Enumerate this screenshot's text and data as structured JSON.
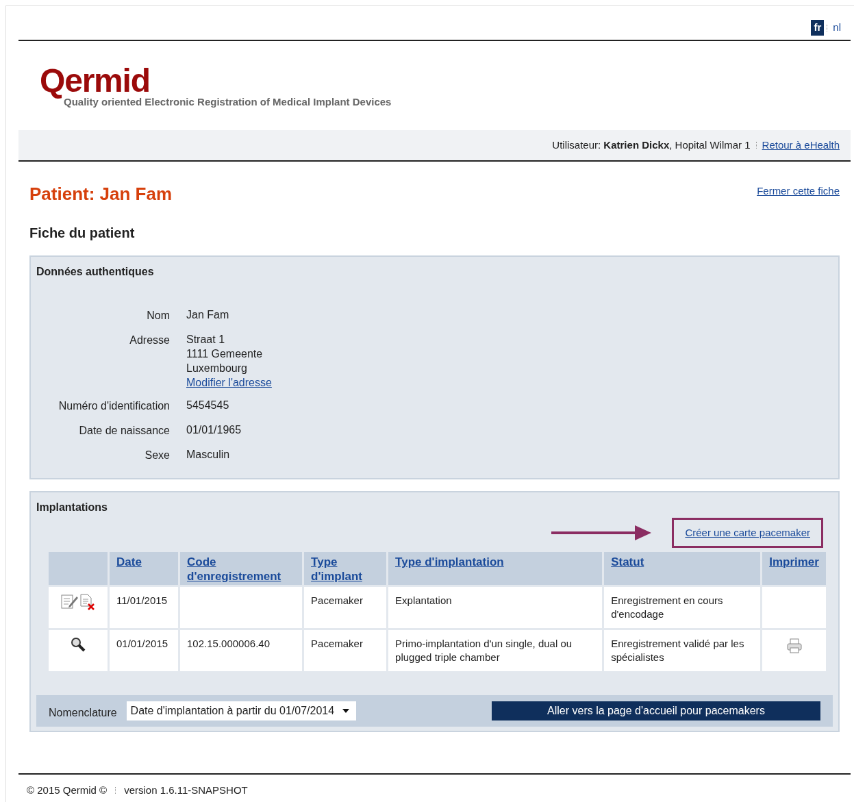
{
  "languages": [
    {
      "label": "fr",
      "selected": true
    },
    {
      "label": "nl",
      "selected": false
    }
  ],
  "logo": {
    "name": "Qermid",
    "tagline": "Quality oriented Electronic Registration of Medical Implant Devices"
  },
  "user_bar": {
    "prefix": "Utilisateur:",
    "user": "Katrien Dickx",
    "org": ", Hopital Wilmar 1",
    "link": "Retour à eHealth"
  },
  "page_title": "Patient: Jan Fam",
  "close_link": "Fermer cette fiche",
  "section_title": "Fiche du patient",
  "authentic": {
    "title": "Données authentiques",
    "fields": [
      {
        "label": "Nom",
        "lines": [
          "Jan Fam"
        ]
      },
      {
        "label": "Adresse",
        "lines": [
          "Straat 1",
          "1111 Gemeente",
          "Luxembourg"
        ],
        "link": "Modifier l'adresse"
      },
      {
        "label": "Numéro d'identification",
        "lines": [
          "5454545"
        ]
      },
      {
        "label": "Date de naissance",
        "lines": [
          "01/01/1965"
        ]
      },
      {
        "label": "Sexe",
        "lines": [
          "Masculin"
        ]
      }
    ]
  },
  "implantations": {
    "title": "Implantations",
    "create_link": {
      "label": "Créer une carte pacemaker",
      "highlighted": true
    },
    "columns": [
      "Date",
      "Code d'enregistrement",
      "Type d'implant",
      "Type d'implantation",
      "Statut",
      "Imprimer"
    ],
    "rows": [
      {
        "can_edit": true,
        "can_delete": true,
        "can_view": false,
        "cells": [
          "11/01/2015",
          "",
          "Pacemaker",
          "Explantation",
          "Enregistrement en cours d'encodage"
        ],
        "printable": false
      },
      {
        "can_edit": false,
        "can_delete": false,
        "can_view": true,
        "cells": [
          "01/01/2015",
          "102.15.000006.40",
          "Pacemaker",
          "Primo-implantation d'un single, dual ou plugged triple chamber",
          "Enregistrement validé par les spécialistes"
        ],
        "printable": true
      }
    ],
    "nomenclature_label": "Nomenclature",
    "nomenclature_value": "Date d'implantation à partir du 01/07/2014",
    "home_button": "Aller vers la page d'accueil pour pacemakers"
  },
  "footer": {
    "copyright": "© 2015  Qermid ©",
    "version": "version 1.6.11-SNAPSHOT"
  }
}
